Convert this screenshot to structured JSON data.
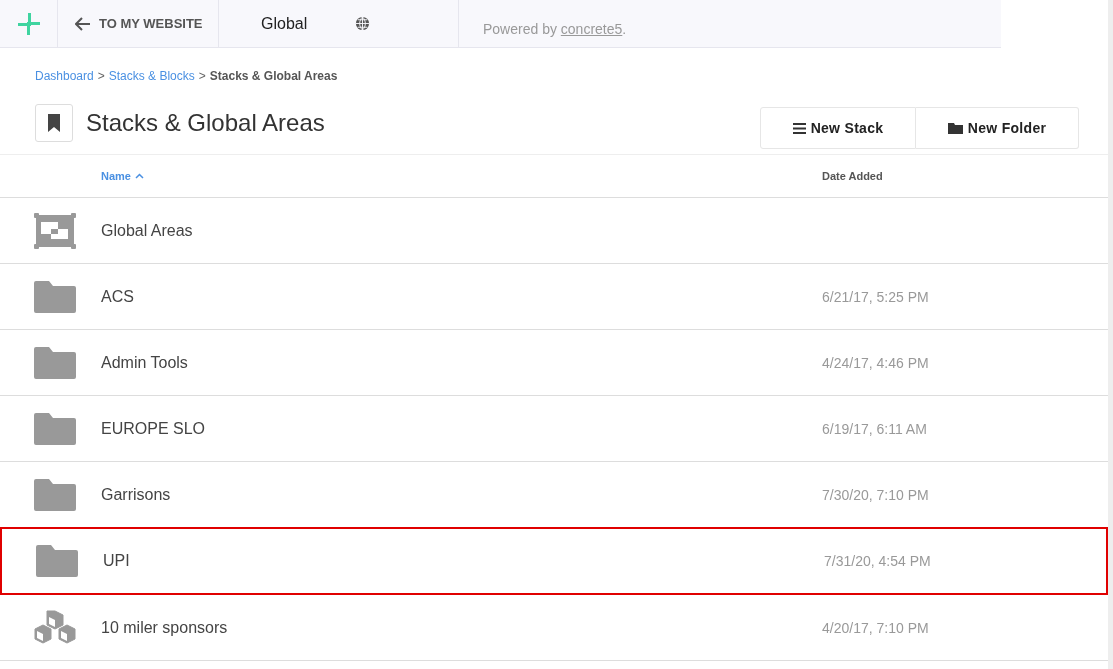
{
  "toolbar": {
    "back_link": "TO MY WEBSITE",
    "locale": "Global",
    "powered_by": "Powered by ",
    "powered_link": "concrete5",
    "powered_end": "."
  },
  "breadcrumb": [
    {
      "label": "Dashboard",
      "kind": "link"
    },
    {
      "label": "Stacks & Blocks",
      "kind": "link"
    },
    {
      "label": "Stacks & Global Areas",
      "kind": "current"
    }
  ],
  "breadcrumb_separator": ">",
  "page_title": "Stacks & Global Areas",
  "buttons": [
    {
      "label": "New Stack",
      "kind": "stack"
    },
    {
      "label": "New Folder",
      "kind": "folder"
    }
  ],
  "table": {
    "columns": [
      {
        "label": "Name",
        "sorted": true
      },
      {
        "label": "Date Added",
        "sorted": false
      }
    ],
    "rows": [
      {
        "kind": "global",
        "name": "Global Areas",
        "date": "",
        "highlighted": false
      },
      {
        "kind": "folder",
        "name": "ACS",
        "date": "6/21/17, 5:25 PM",
        "highlighted": false
      },
      {
        "kind": "folder",
        "name": "Admin Tools",
        "date": "4/24/17, 4:46 PM",
        "highlighted": false
      },
      {
        "kind": "folder",
        "name": "EUROPE SLO",
        "date": "6/19/17, 6:11 AM",
        "highlighted": false
      },
      {
        "kind": "folder",
        "name": "Garrisons",
        "date": "7/30/20, 7:10 PM",
        "highlighted": false
      },
      {
        "kind": "folder",
        "name": "UPI",
        "date": "7/31/20, 4:54 PM",
        "highlighted": true
      },
      {
        "kind": "stack",
        "name": "10 miler sponsors",
        "date": "4/20/17, 7:10 PM",
        "highlighted": false
      }
    ]
  }
}
